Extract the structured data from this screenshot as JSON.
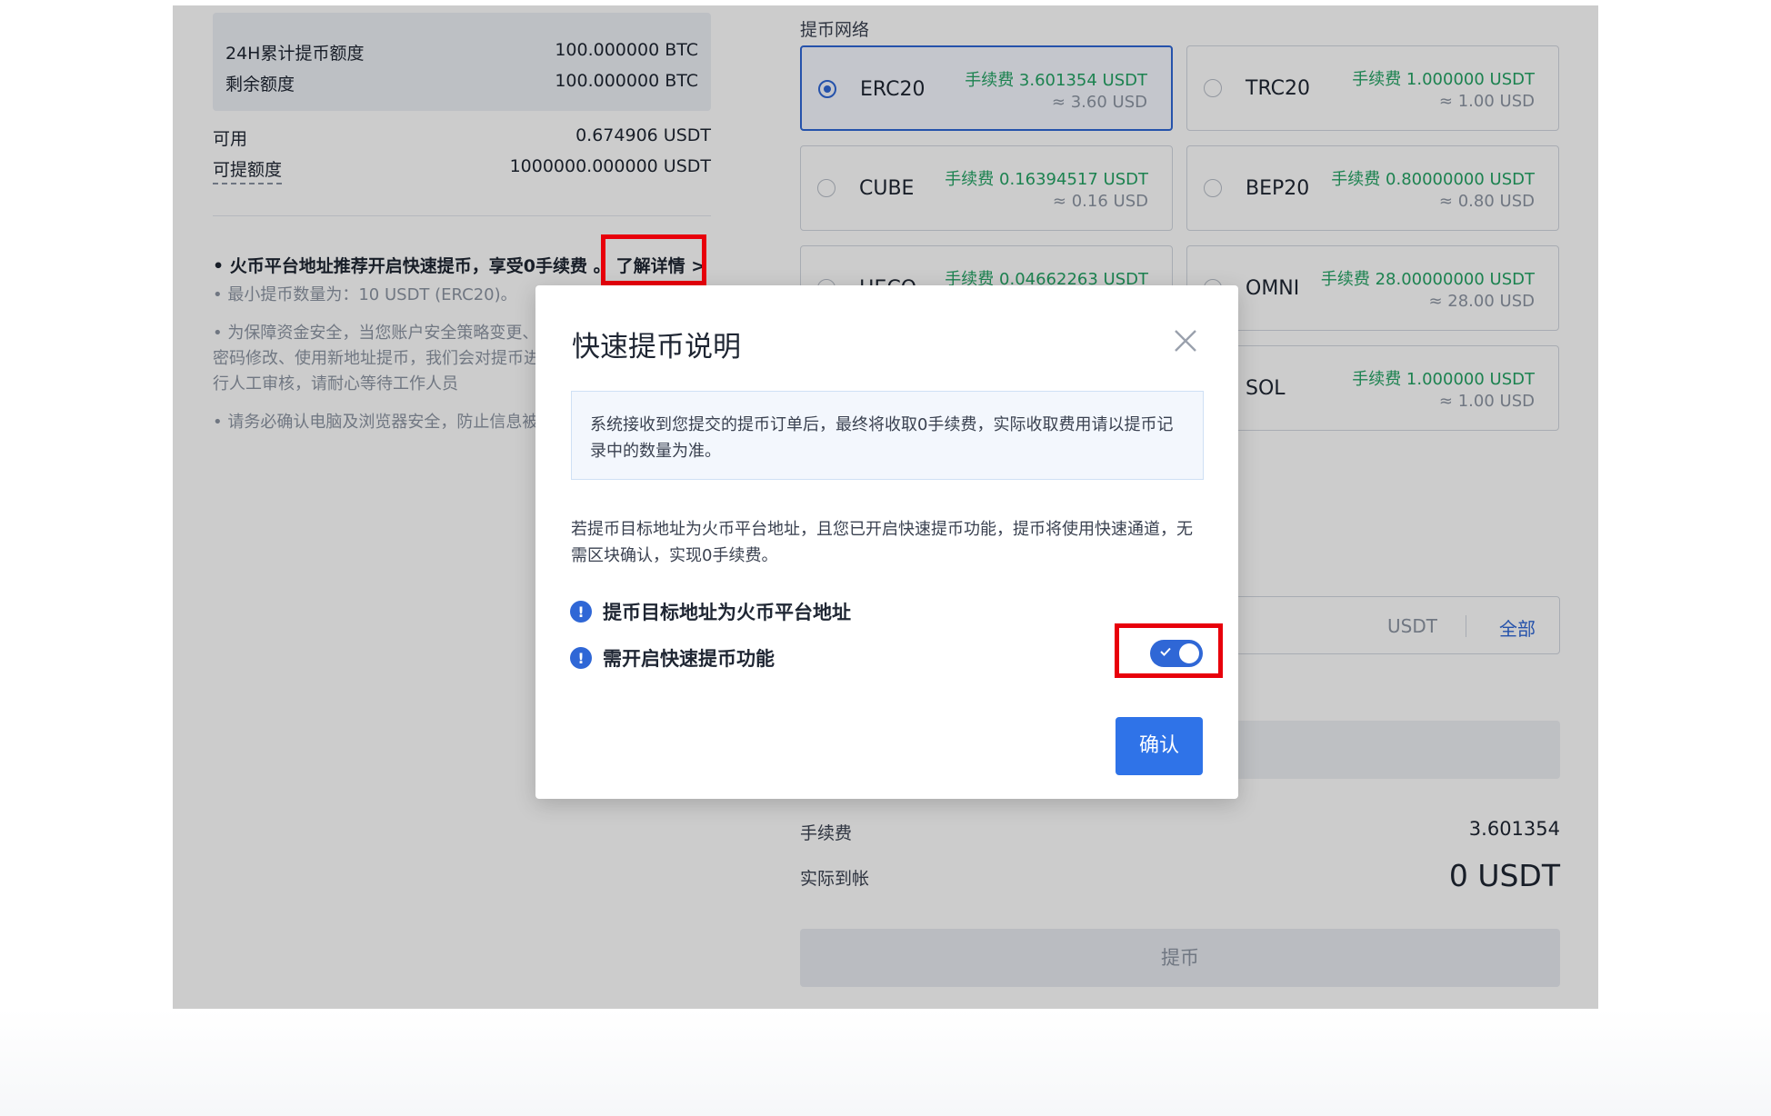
{
  "quota": {
    "label_24h": "24H累计提币额度",
    "value_24h": "100.000000 BTC",
    "label_remaining": "剩余额度",
    "value_remaining": "100.000000 BTC"
  },
  "balance": {
    "available_label": "可用",
    "available_value": "0.674906 USDT",
    "withdrawable_label": "可提额度",
    "withdrawable_value": "1000000.000000 USDT"
  },
  "notes": {
    "promo": "• 火币平台地址推荐开启快速提币，享受0手续费 。",
    "learn_more": "了解详情 >",
    "min_amount": "• 最小提币数量为：10 USDT (ERC20)。",
    "security": "• 为保障资金安全，当您账户安全策略变更、密码修改、使用新地址提币，我们会对提币进行人工审核，请耐心等待工作人员",
    "device": "• 请务必确认电脑及浏览器安全，防止信息被篡改或泄露。"
  },
  "network": {
    "title": "提币网络",
    "cards": [
      {
        "name": "ERC20",
        "fee": "手续费 3.601354 USDT",
        "approx": "≈ 3.60 USD",
        "selected": true
      },
      {
        "name": "TRC20",
        "fee": "手续费 1.000000 USDT",
        "approx": "≈ 1.00 USD",
        "selected": false
      },
      {
        "name": "CUBE",
        "fee": "手续费 0.16394517 USDT",
        "approx": "≈ 0.16 USD",
        "selected": false
      },
      {
        "name": "BEP20",
        "fee": "手续费 0.80000000 USDT",
        "approx": "≈ 0.80 USD",
        "selected": false
      },
      {
        "name": "HECO",
        "fee": "手续费 0.04662263 USDT",
        "approx": "",
        "selected": false
      },
      {
        "name": "OMNI",
        "fee": "手续费 28.00000000 USDT",
        "approx": "≈ 28.00 USD",
        "selected": false
      },
      {
        "name": "",
        "fee": "",
        "approx": "",
        "selected": false
      },
      {
        "name": "SOL",
        "fee": "手续费 1.000000 USDT",
        "approx": "≈ 1.00 USD",
        "selected": false
      }
    ]
  },
  "amount": {
    "unit": "USDT",
    "all": "全部"
  },
  "summary": {
    "fee_label": "手续费",
    "fee_value": "3.601354",
    "received_label": "实际到帐",
    "received_value": "0 USDT",
    "withdraw_button": "提币"
  },
  "modal": {
    "title": "快速提币说明",
    "notice": "系统接收到您提交的提币订单后，最终将收取0手续费，实际收取费用请以提币记录中的数量为准。",
    "description": "若提币目标地址为火币平台地址，且您已开启快速提币功能，提币将使用快速通道，无需区块确认，实现0手续费。",
    "condition_1": "提币目标地址为火币平台地址",
    "condition_2": "需开启快速提币功能",
    "toggle_on": true,
    "confirm": "确认"
  },
  "colors": {
    "accent": "#2f67d6",
    "fee_green": "#24a364",
    "highlight_red": "#e8000b"
  }
}
